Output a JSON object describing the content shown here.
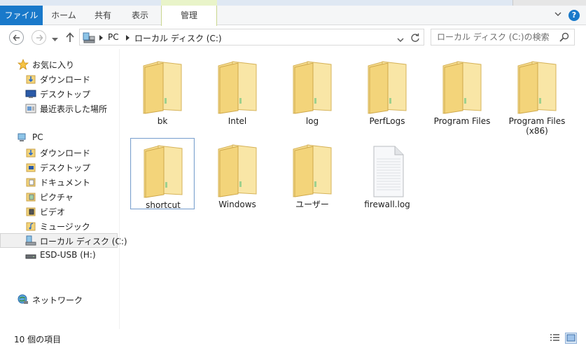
{
  "ribbon": {
    "file_tab": "ファイル",
    "tabs": [
      "ホーム",
      "共有",
      "表示"
    ],
    "manage_tab": "管理",
    "help_label": "?"
  },
  "address": {
    "crumbs": [
      "PC",
      "ローカル ディスク (C:)"
    ],
    "search_placeholder": "ローカル ディスク (C:)の検索"
  },
  "nav": {
    "favorites": {
      "label": "お気に入り",
      "items": [
        "ダウンロード",
        "デスクトップ",
        "最近表示した場所"
      ]
    },
    "pc": {
      "label": "PC",
      "items": [
        "ダウンロード",
        "デスクトップ",
        "ドキュメント",
        "ピクチャ",
        "ビデオ",
        "ミュージック",
        "ローカル ディスク (C:)",
        "ESD-USB (H:)"
      ]
    },
    "network": "ネットワーク"
  },
  "content": {
    "items": [
      {
        "name": "bk",
        "type": "folder"
      },
      {
        "name": "Intel",
        "type": "folder"
      },
      {
        "name": "log",
        "type": "folder"
      },
      {
        "name": "PerfLogs",
        "type": "folder"
      },
      {
        "name": "Program Files",
        "type": "folder"
      },
      {
        "name": "Program Files (x86)",
        "type": "folder"
      },
      {
        "name": "shortcut",
        "type": "folder",
        "selected": true
      },
      {
        "name": "Windows",
        "type": "folder"
      },
      {
        "name": "ユーザー",
        "type": "folder"
      },
      {
        "name": "firewall.log",
        "type": "file"
      }
    ]
  },
  "status": {
    "count": "10 個の項目"
  },
  "colors": {
    "accent": "#1979ca",
    "folder": "#f3d47a",
    "selection_border": "#7da2ce"
  }
}
